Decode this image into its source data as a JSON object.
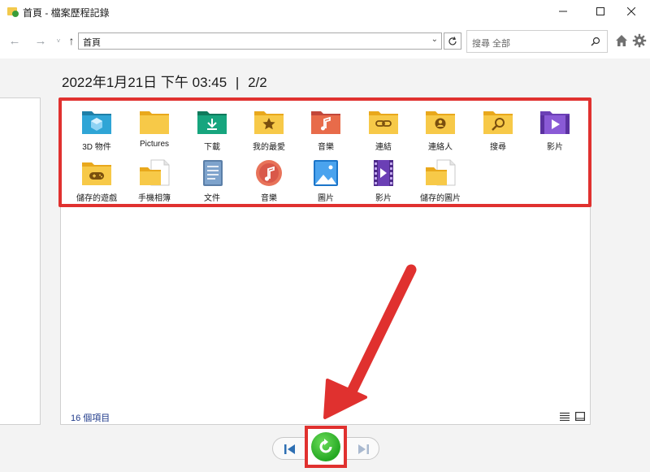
{
  "window": {
    "title": "首頁 - 檔案歷程記錄"
  },
  "address_bar": {
    "path": "首頁",
    "search_placeholder": "搜尋 全部"
  },
  "snapshot": {
    "date": "2022年1月21日 下午 03:45",
    "separator": "|",
    "page": "2/2"
  },
  "items": [
    {
      "label": "3D 物件",
      "icon": "3d-objects-icon"
    },
    {
      "label": "Pictures",
      "icon": "folder-icon"
    },
    {
      "label": "下載",
      "icon": "downloads-folder-icon"
    },
    {
      "label": "我的最愛",
      "icon": "favorites-folder-icon"
    },
    {
      "label": "音樂",
      "icon": "music-folder-icon"
    },
    {
      "label": "連結",
      "icon": "links-folder-icon"
    },
    {
      "label": "連絡人",
      "icon": "contacts-folder-icon"
    },
    {
      "label": "搜尋",
      "icon": "searches-folder-icon"
    },
    {
      "label": "影片",
      "icon": "videos-folder-icon"
    },
    {
      "label": "儲存的遊戲",
      "icon": "saved-games-folder-icon"
    },
    {
      "label": "手機相簿",
      "icon": "camera-roll-folder-icon"
    },
    {
      "label": "文件",
      "icon": "documents-library-icon"
    },
    {
      "label": "音樂",
      "icon": "music-library-icon"
    },
    {
      "label": "圖片",
      "icon": "pictures-library-icon"
    },
    {
      "label": "影片",
      "icon": "videos-library-icon"
    },
    {
      "label": "儲存的圖片",
      "icon": "saved-pictures-folder-icon"
    }
  ],
  "status": {
    "item_count": "16 個項目"
  },
  "colors": {
    "highlight": "#e0312f",
    "restore_green": "#25a822",
    "folder_yellow": "#f7c948"
  }
}
